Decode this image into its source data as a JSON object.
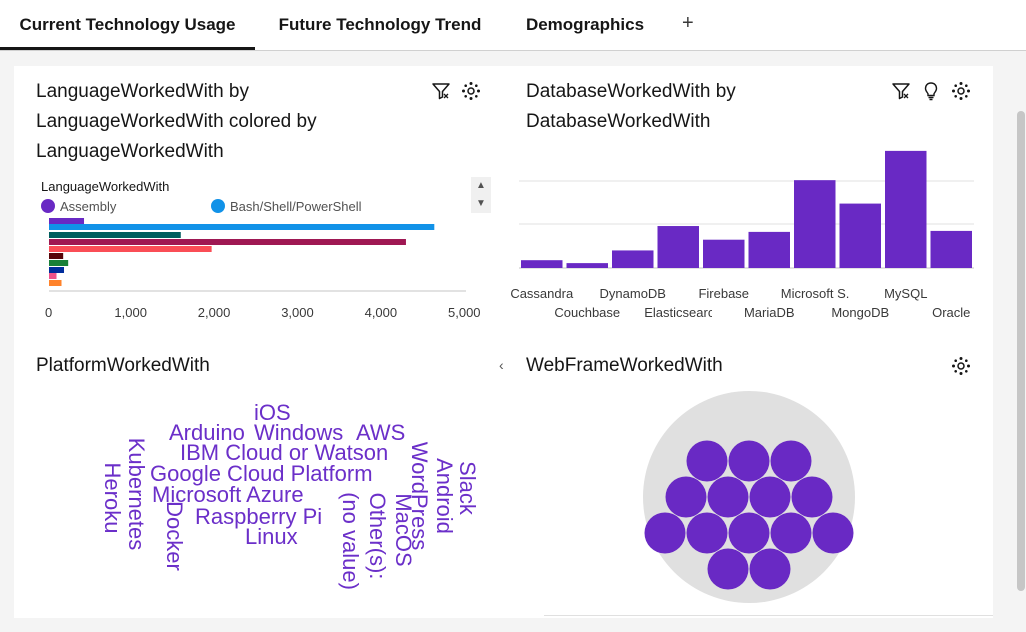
{
  "tabs": [
    {
      "label": "Current Technology Usage",
      "active": true
    },
    {
      "label": "Future Technology Trend",
      "active": false
    },
    {
      "label": "Demographics",
      "active": false
    }
  ],
  "add_tab_label": "+",
  "panels": {
    "language": {
      "title_lines": [
        "LanguageWorkedWith by",
        "LanguageWorkedWith colored by",
        "LanguageWorkedWith"
      ],
      "legend_title": "LanguageWorkedWith",
      "legend_items": [
        {
          "label": "Assembly",
          "color": "#6929c4"
        },
        {
          "label": "Bash/Shell/PowerShell",
          "color": "#1192e8"
        }
      ]
    },
    "database": {
      "title_lines": [
        "DatabaseWorkedWith by",
        "DatabaseWorkedWith"
      ]
    },
    "platform": {
      "title": "PlatformWorkedWith"
    },
    "webframe": {
      "title": "WebFrameWorkedWith"
    }
  },
  "chart_data": [
    {
      "type": "bar",
      "orientation": "horizontal",
      "xlim": [
        0,
        5000
      ],
      "x_ticks": [
        "0",
        "1,000",
        "2,000",
        "3,000",
        "4,000",
        "5,000"
      ],
      "values": [
        420,
        4620,
        1580,
        4280,
        1950,
        170,
        230,
        180,
        90,
        150
      ],
      "colors": [
        "#6929c4",
        "#1192e8",
        "#005d5d",
        "#9f1853",
        "#fa4d56",
        "#570408",
        "#198038",
        "#002d9c",
        "#ee538b",
        "#ff832b"
      ],
      "legend": [
        "Assembly",
        "Bash/Shell/PowerShell"
      ]
    },
    {
      "type": "bar",
      "categories": [
        "Cassandra",
        "Couchbase",
        "DynamoDB",
        "Elasticsearch",
        "Firebase",
        "MariaDB",
        "Microsoft S...",
        "MongoDB",
        "MySQL",
        "Oracle"
      ],
      "values": [
        8,
        5,
        18,
        43,
        29,
        37,
        90,
        66,
        120,
        38
      ],
      "ylim": [
        0,
        125
      ],
      "grid": true,
      "color": "#6929c4"
    }
  ],
  "wordcloud": [
    {
      "text": "iOS"
    },
    {
      "text": "Arduino"
    },
    {
      "text": "Windows"
    },
    {
      "text": "AWS"
    },
    {
      "text": "IBM Cloud or Watson"
    },
    {
      "text": "Google Cloud Platform"
    },
    {
      "text": "Microsoft Azure"
    },
    {
      "text": "Raspberry Pi"
    },
    {
      "text": "Linux"
    },
    {
      "text": "Heroku"
    },
    {
      "text": "Kubernetes"
    },
    {
      "text": "Docker"
    },
    {
      "text": "(no value)"
    },
    {
      "text": "Other(s):"
    },
    {
      "text": "MacOS"
    },
    {
      "text": "WordPress"
    },
    {
      "text": "Android"
    },
    {
      "text": "Slack"
    }
  ],
  "packed_bubbles": {
    "count": 15,
    "color": "#6929c4",
    "container_color": "#e0e0e0"
  },
  "colors": {
    "accent": "#6929c4",
    "tab_underline": "#161616"
  }
}
